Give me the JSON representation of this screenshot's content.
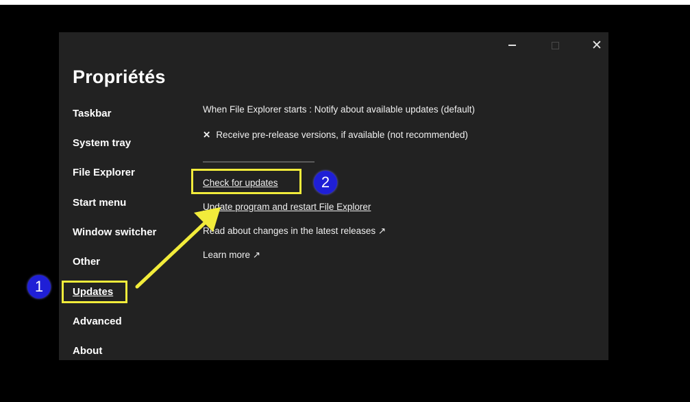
{
  "window": {
    "title": "Propriétés",
    "controls": {
      "minimize_icon": "minimize-icon",
      "maximize_icon": "maximize-icon",
      "close_glyph": "✕"
    }
  },
  "sidebar": {
    "items": [
      {
        "label": "Taskbar"
      },
      {
        "label": "System tray"
      },
      {
        "label": "File Explorer"
      },
      {
        "label": "Start menu"
      },
      {
        "label": "Window switcher"
      },
      {
        "label": "Other"
      },
      {
        "label": "Updates",
        "active": true
      },
      {
        "label": "Advanced"
      },
      {
        "label": "About"
      }
    ]
  },
  "content": {
    "startup_option": "When File Explorer starts : Notify about available updates (default)",
    "prerelease_mark": "✕",
    "prerelease_option": "Receive pre-release versions, if available (not recommended)",
    "check_updates": "Check for updates",
    "update_restart": "Update program and restart File Explorer",
    "read_changes": "Read about changes in the latest releases ↗",
    "learn_more": "Learn more ↗"
  },
  "annotations": {
    "badge_1": "1",
    "badge_2": "2",
    "highlight_color": "#f2ec3b",
    "badge_color": "#1f1fd6"
  }
}
